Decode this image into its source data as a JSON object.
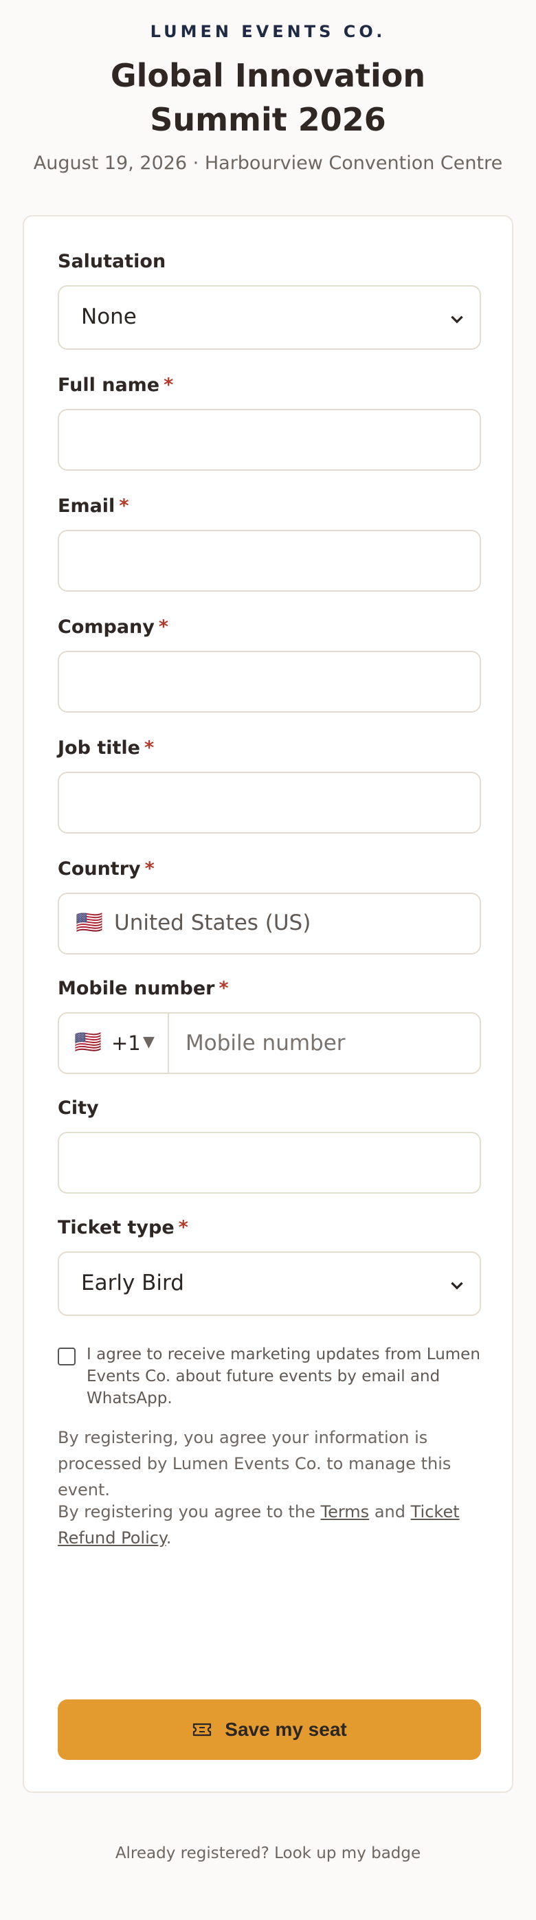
{
  "header": {
    "brand": "LUMEN EVENTS CO.",
    "title_line1": "Global Innovation",
    "title_line2": "Summit 2026",
    "subtitle": "August 19, 2026 · Harbourview Convention Centre"
  },
  "form": {
    "salutation": {
      "label": "Salutation",
      "value": "None"
    },
    "full_name": {
      "label": "Full name",
      "required": "*",
      "value": ""
    },
    "email": {
      "label": "Email",
      "required": "*",
      "value": ""
    },
    "company": {
      "label": "Company",
      "required": "*",
      "value": ""
    },
    "job_title": {
      "label": "Job title",
      "required": "*",
      "value": ""
    },
    "country": {
      "label": "Country",
      "required": "*",
      "flag": "🇺🇸",
      "value": "United States (US)"
    },
    "mobile": {
      "label": "Mobile number",
      "required": "*",
      "flag": "🇺🇸",
      "dial_code": "+1",
      "caret": "▼",
      "placeholder": "Mobile number",
      "value": ""
    },
    "city": {
      "label": "City",
      "value": ""
    },
    "ticket_type": {
      "label": "Ticket type",
      "required": "*",
      "value": "Early Bird"
    },
    "marketing_consent": {
      "checked": false,
      "text": "I agree to receive marketing updates from Lumen Events Co. about future events by email and WhatsApp."
    },
    "data_note": "By registering, you agree your information is processed by Lumen Events Co. to manage this event.",
    "terms_note": {
      "prefix": "By registering you agree to the ",
      "terms_link": "Terms",
      "middle": " and ",
      "refund_link": "Ticket Refund Policy",
      "suffix": "."
    },
    "submit_label": "Save my seat",
    "submit_icon": "ticket-icon"
  },
  "footer": {
    "lookup_link": "Already registered? Look up my badge"
  },
  "colors": {
    "accent": "#e39b30",
    "required": "#b23a2b",
    "brand": "#1f2a44",
    "background": "#fbfaf8"
  }
}
